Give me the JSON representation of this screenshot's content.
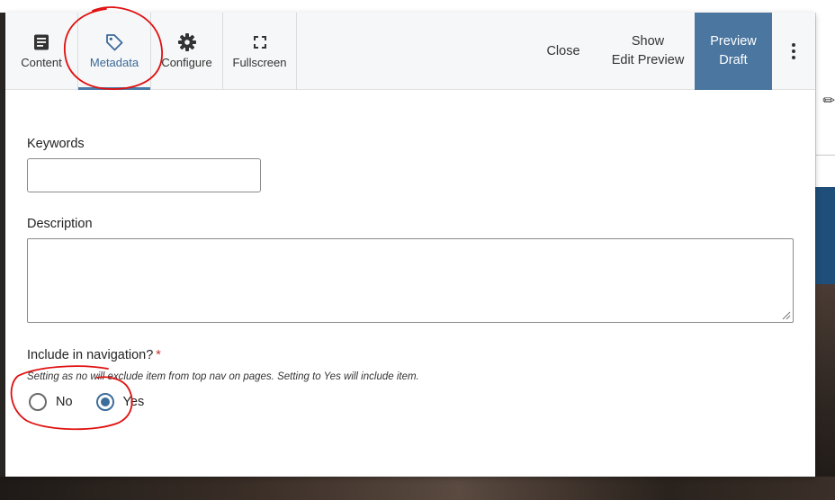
{
  "toolbar": {
    "content_label": "Content",
    "metadata_label": "Metadata",
    "configure_label": "Configure",
    "fullscreen_label": "Fullscreen",
    "close_label": "Close",
    "show_edit_preview_line1": "Show",
    "show_edit_preview_line2": "Edit Preview",
    "preview_draft_line1": "Preview",
    "preview_draft_line2": "Draft",
    "active_tab": "Metadata"
  },
  "form": {
    "keywords_label": "Keywords",
    "keywords_value": "",
    "description_label": "Description",
    "description_value": "",
    "nav_label": "Include in navigation?",
    "nav_required_mark": "*",
    "nav_help": "Setting as no will exclude item from top nav on pages. Setting to Yes will include item.",
    "nav_options": [
      {
        "label": "No",
        "checked": false
      },
      {
        "label": "Yes",
        "checked": true
      }
    ]
  },
  "colors": {
    "accent": "#4a76a0",
    "active_tab": "#3a6a9a",
    "annotation": "#e01010",
    "required": "#c0392b"
  },
  "icons": [
    "content-icon",
    "tag-icon",
    "gear-icon",
    "fullscreen-icon",
    "kebab-icon"
  ]
}
